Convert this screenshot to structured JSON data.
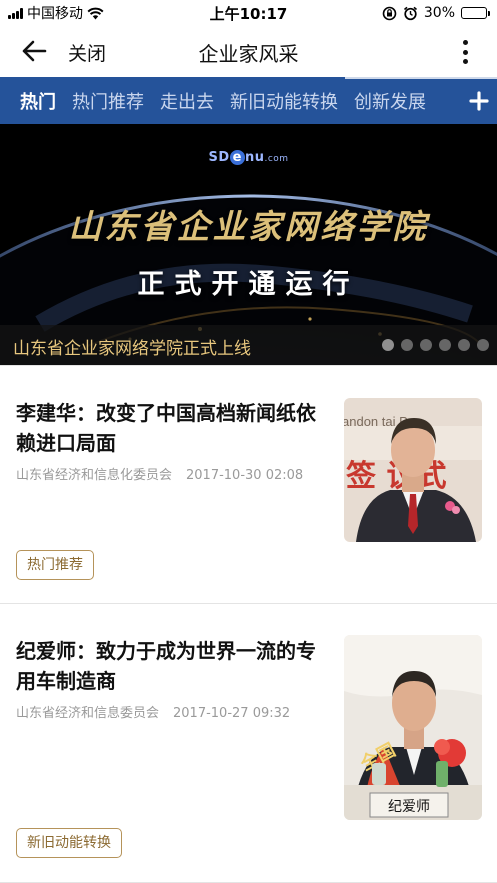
{
  "status_bar": {
    "carrier": "中国移动",
    "time": "上午10:17",
    "battery": "30%",
    "battery_level": 0.3
  },
  "nav": {
    "close_label": "关闭",
    "title": "企业家风采"
  },
  "tabs": [
    {
      "label": "热门",
      "active": true
    },
    {
      "label": "热门推荐"
    },
    {
      "label": "走出去"
    },
    {
      "label": "新旧动能转换"
    },
    {
      "label": "创新发展"
    }
  ],
  "banner": {
    "logo_text": "SD",
    "logo_e": "e",
    "logo_rest": "nu",
    "logo_suffix": ".com",
    "headline": "山东省企业家网络学院",
    "subheadline": "正式开通运行",
    "caption": "山东省企业家网络学院正式上线",
    "slide_count": 6,
    "active_slide": 0
  },
  "articles": [
    {
      "title": "李建华：改变了中国高档新闻纸依赖进口局面",
      "source": "山东省经济和信息化委员会",
      "date": "2017-10-30 02:08",
      "tag": "热门推荐",
      "thumb_backdrop_text": "andon   tai Pa",
      "thumb_banner_text": "签  议式"
    },
    {
      "title": "纪爱师：致力于成为世界一流的专用车制造商",
      "source": "山东省经济和信息委员会",
      "date": "2017-10-27 09:32",
      "tag": "新旧动能转换",
      "thumb_nameplate": "纪爱师",
      "thumb_sash_text": "全国"
    }
  ],
  "colors": {
    "tab_bar": "#25539a",
    "tag_border": "#b5935a",
    "banner_gold": "#dcc07a"
  }
}
